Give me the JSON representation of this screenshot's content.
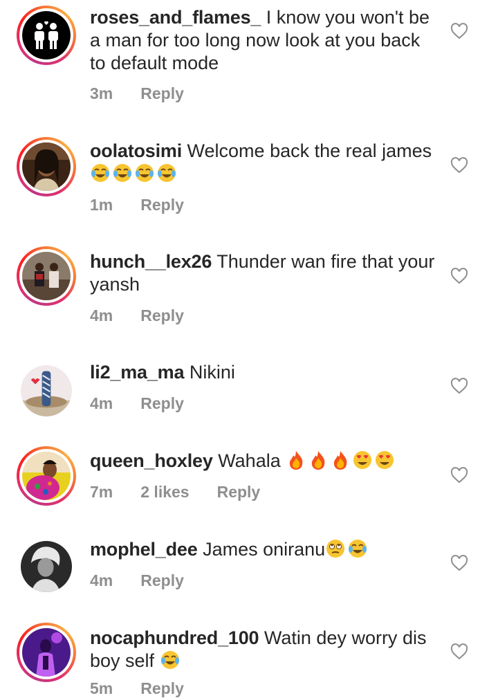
{
  "comments": [
    {
      "username": "roses_and_flames_",
      "text": "I know you won't be a man for too long now look at you back to default mode",
      "time": "3m",
      "likes": "",
      "reply": "Reply",
      "avatar": "couple-icon-avatar",
      "story_ring": true
    },
    {
      "username": "oolatosimi",
      "text": "Welcome back the real james",
      "emojis": [
        "tears-of-joy",
        "tears-of-joy",
        "tears-of-joy",
        "tears-of-joy"
      ],
      "time": "1m",
      "likes": "",
      "reply": "Reply",
      "avatar": "photo-avatar",
      "story_ring": true
    },
    {
      "username": "hunch__lex26",
      "text": "Thunder wan fire that your yansh",
      "time": "4m",
      "likes": "",
      "reply": "Reply",
      "avatar": "photo-avatar",
      "story_ring": true
    },
    {
      "username": "li2_ma_ma",
      "text": "Nikini",
      "time": "4m",
      "likes": "",
      "reply": "Reply",
      "avatar": "photo-avatar",
      "story_ring": false
    },
    {
      "username": "queen_hoxley",
      "text": "Wahala",
      "emojis": [
        "fire",
        "fire",
        "fire",
        "heart-eyes",
        "heart-eyes"
      ],
      "time": "7m",
      "likes": "2 likes",
      "reply": "Reply",
      "avatar": "photo-avatar",
      "story_ring": true
    },
    {
      "username": "mophel_dee",
      "text": "James oniranu",
      "emojis": [
        "rolling-eyes",
        "tears-of-joy"
      ],
      "time": "4m",
      "likes": "",
      "reply": "Reply",
      "avatar": "photo-avatar",
      "story_ring": false
    },
    {
      "username": "nocaphundred_100",
      "text": "Watin dey worry dis boy self",
      "emojis": [
        "tears-of-joy"
      ],
      "time": "5m",
      "likes": "",
      "reply": "Reply",
      "avatar": "photo-avatar",
      "story_ring": true
    }
  ],
  "icons": {
    "like": "heart-outline-icon"
  },
  "colors": {
    "text": "#262626",
    "meta": "#8e8e8e",
    "ring_start": "#c13584",
    "ring_end": "#fcaf45"
  }
}
